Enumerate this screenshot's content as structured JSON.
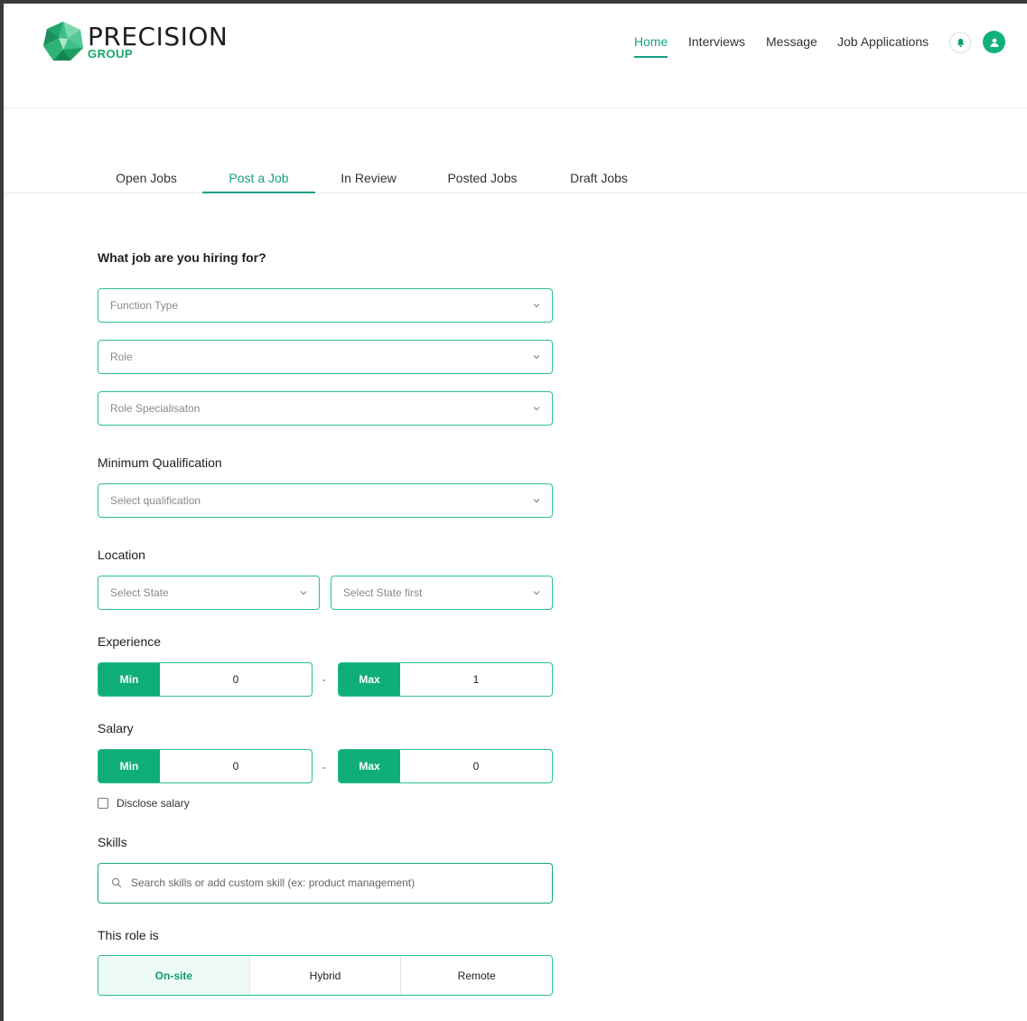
{
  "brand": {
    "name": "PRECISION",
    "sub": "GROUP"
  },
  "nav": {
    "items": [
      {
        "label": "Home",
        "active": true
      },
      {
        "label": "Interviews"
      },
      {
        "label": "Message"
      },
      {
        "label": "Job Applications"
      }
    ]
  },
  "tabs": [
    {
      "label": "Open Jobs"
    },
    {
      "label": "Post a Job",
      "active": true
    },
    {
      "label": "In Review"
    },
    {
      "label": "Posted Jobs"
    },
    {
      "label": "Draft Jobs"
    }
  ],
  "form": {
    "hiring_title": "What job are you hiring for?",
    "function_type": "Function Type",
    "role": "Role",
    "role_specialisation": "Role Specialisaton",
    "qualification_title": "Minimum Qualification",
    "qualification": "Select qualification",
    "location_title": "Location",
    "state": "Select State",
    "city": "Select State first",
    "experience_title": "Experience",
    "experience": {
      "min_label": "Min",
      "min": "0",
      "max_label": "Max",
      "max": "1",
      "sep": "-"
    },
    "salary_title": "Salary",
    "salary": {
      "min_label": "Min",
      "min": "0",
      "max_label": "Max",
      "max": "0",
      "sep": "-"
    },
    "disclose_salary": "Disclose salary",
    "skills_title": "Skills",
    "skills_placeholder": "Search skills or add custom skill (ex: product management)",
    "role_is_title": "This role is",
    "role_options": [
      "On-site",
      "Hybrid",
      "Remote"
    ]
  },
  "colors": {
    "accent": "#16a086",
    "primary_green": "#0fae76",
    "border": "#2bbf9a"
  }
}
